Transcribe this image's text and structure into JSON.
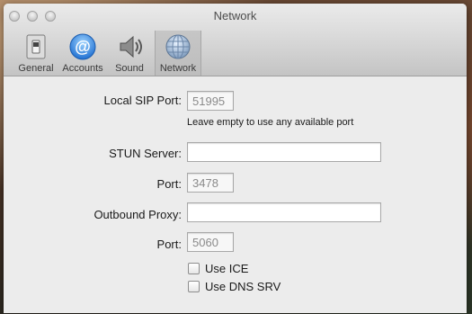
{
  "window": {
    "title": "Network"
  },
  "toolbar": {
    "items": [
      {
        "label": "General",
        "icon": "switch-icon",
        "selected": false
      },
      {
        "label": "Accounts",
        "icon": "at-sign-icon",
        "selected": false
      },
      {
        "label": "Sound",
        "icon": "speaker-icon",
        "selected": false
      },
      {
        "label": "Network",
        "icon": "globe-icon",
        "selected": true
      }
    ]
  },
  "form": {
    "local_sip_port": {
      "label": "Local SIP Port:",
      "placeholder": "51995",
      "hint": "Leave empty to use any available port"
    },
    "stun_server": {
      "label": "STUN Server:",
      "value": ""
    },
    "stun_port": {
      "label": "Port:",
      "placeholder": "3478"
    },
    "outbound_proxy": {
      "label": "Outbound Proxy:",
      "value": ""
    },
    "proxy_port": {
      "label": "Port:",
      "placeholder": "5060"
    },
    "use_ice": {
      "label": "Use ICE",
      "checked": false
    },
    "use_dns_srv": {
      "label": "Use DNS SRV",
      "checked": false
    }
  }
}
